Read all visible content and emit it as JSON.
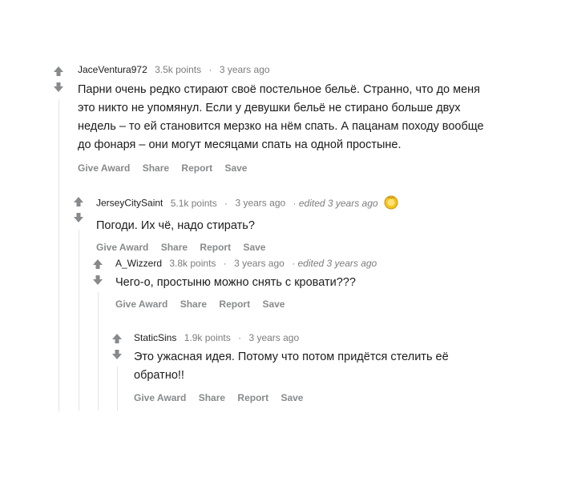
{
  "comments": [
    {
      "author": "JaceVentura972",
      "points": "3.5k points",
      "dot": "·",
      "time": "3 years ago",
      "edited": "",
      "body": "Парни очень редко стирают своё постельное бельё. Странно, что до меня это никто не упомянул. Если у девушки бельё не стирано больше двух недель – то ей становится мерзко на нём спать. А пацанам походу вообще до фонаря – они могут месяцами спать на одной простыне.",
      "actions": [
        "Give Award",
        "Share",
        "Report",
        "Save"
      ]
    },
    {
      "author": "JerseyCitySaint",
      "points": "5.1k points",
      "dot": "·",
      "time": "3 years ago",
      "edited": "· edited 3 years ago",
      "award": "gold-award-icon",
      "body": "Погоди. Их чё, надо стирать?",
      "actions": [
        "Give Award",
        "Share",
        "Report",
        "Save"
      ]
    },
    {
      "author": "A_Wizzerd",
      "points": "3.8k points",
      "dot": "·",
      "time": "3 years ago",
      "edited": "· edited 3 years ago",
      "body": "Чего-о, простыню можно снять с кровати???",
      "actions": [
        "Give Award",
        "Share",
        "Report",
        "Save"
      ]
    },
    {
      "author": "StaticSins",
      "points": "1.9k points",
      "dot": "·",
      "time": "3 years ago",
      "edited": "",
      "body": "Это ужасная идея. Потому что потом придётся стелить её обратно!!",
      "actions": [
        "Give Award",
        "Share",
        "Report",
        "Save"
      ]
    }
  ],
  "colors": {
    "vote_arrow": "#878a8c",
    "thread_line": "#e4e4e4",
    "meta": "#7c7c7c"
  },
  "icons": {
    "upvote": "upvote-arrow-icon",
    "downvote": "downvote-arrow-icon"
  }
}
